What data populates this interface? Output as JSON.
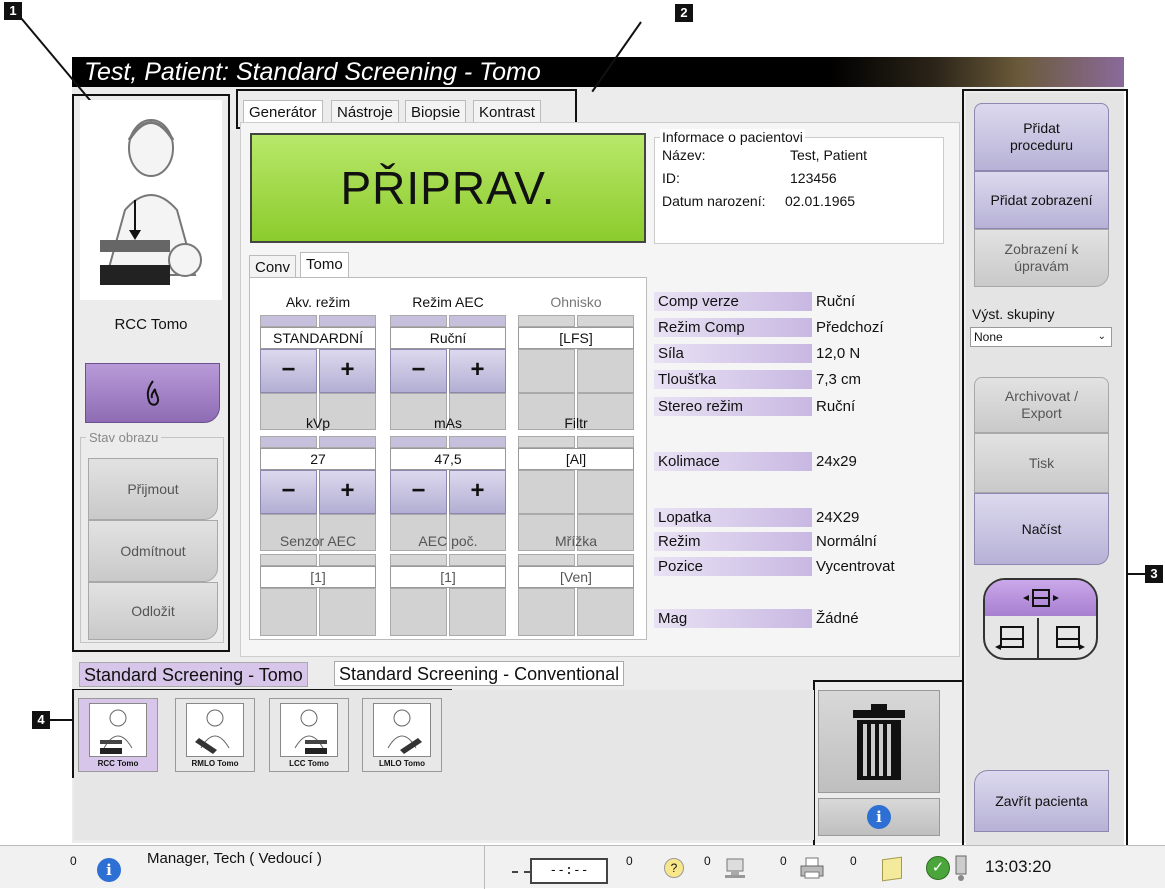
{
  "window": {
    "title": "Test, Patient:  Standard Screening - Tomo"
  },
  "callouts": {
    "c1": "1",
    "c2": "2",
    "c3": "3",
    "c4": "4"
  },
  "left_panel": {
    "view_label": "RCC Tomo",
    "expose_icon": "flame-icon",
    "image_state_label": "Stav obrazu",
    "accept": "Přijmout",
    "reject": "Odmítnout",
    "defer": "Odložit"
  },
  "tabs": {
    "generator": "Generátor",
    "tools": "Nástroje",
    "biopsy": "Biopsie",
    "contrast": "Kontrast"
  },
  "ready": "PŘIPRAV.",
  "patient_info": {
    "group_label": "Informace o pacientovi",
    "name_label": "Název:",
    "name": "Test, Patient",
    "id_label": "ID:",
    "id": "123456",
    "dob_label": "Datum narození:",
    "dob": "02.01.1965"
  },
  "mode_tabs": {
    "conv": "Conv",
    "tomo": "Tomo"
  },
  "controls": {
    "acq_mode": {
      "label": "Akv. režim",
      "value": "STANDARDNÍ"
    },
    "aec_mode": {
      "label": "Režim AEC",
      "value": "Ruční"
    },
    "focus": {
      "label": "Ohnisko",
      "value": "[LFS]"
    },
    "kvp": {
      "label": "kVp",
      "value": "27"
    },
    "mas": {
      "label": "mAs",
      "value": "47,5"
    },
    "filter": {
      "label": "Filtr",
      "value": "[Al]"
    },
    "aec_sensor": {
      "label": "Senzor AEC",
      "value": "[1]"
    },
    "aec_count": {
      "label": "AEC poč.",
      "value": "[1]"
    },
    "grid": {
      "label": "Mřížka",
      "value": "[Ven]"
    },
    "minus": "−",
    "plus": "+"
  },
  "exposure_info": [
    {
      "key": "Comp verze",
      "value": "Ruční"
    },
    {
      "key": "Režim Comp",
      "value": "Předchozí"
    },
    {
      "key": "Síla",
      "value": "12,0 N"
    },
    {
      "key": "Tloušťka",
      "value": "7,3 cm"
    },
    {
      "key": "Stereo režim",
      "value": "Ruční"
    },
    {
      "key": "Kolimace",
      "value": "24x29"
    },
    {
      "key": "Lopatka",
      "value": "24X29"
    },
    {
      "key": "Režim",
      "value": "Normální"
    },
    {
      "key": "Pozice",
      "value": "Vycentrovat"
    },
    {
      "key": "Mag",
      "value": "Žádné"
    }
  ],
  "procedure_tabs": {
    "tomo": "Standard Screening - Tomo",
    "conv": "Standard Screening - Conventional"
  },
  "thumbnails": [
    {
      "label": "RCC Tomo"
    },
    {
      "label": "RMLO Tomo"
    },
    {
      "label": "LCC Tomo"
    },
    {
      "label": "LMLO Tomo"
    }
  ],
  "right_panel": {
    "add_procedure": "Přidat proceduru",
    "add_view": "Přidat zobrazení",
    "edit_view": "Zobrazení k úpravám",
    "output_groups_label": "Výst. skupiny",
    "output_groups_value": "None",
    "archive": "Archivovat / Export",
    "print": "Tisk",
    "load": "Načíst",
    "close_patient": "Zavřít pacienta"
  },
  "statusbar": {
    "alerts_count": "0",
    "user": "Manager, Tech ( Vedoucí )",
    "timer": "--:--",
    "count1": "0",
    "count2": "0",
    "count3": "0",
    "count4": "0",
    "time": "13:03:20"
  }
}
